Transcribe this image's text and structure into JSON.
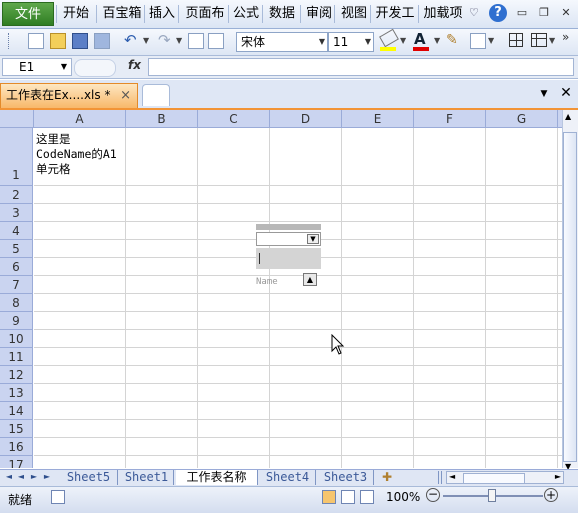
{
  "menu": {
    "file": "文件",
    "items": [
      "开始",
      "百宝箱",
      "插入",
      "页面布",
      "公式",
      "数据",
      "审阅",
      "视图",
      "开发工",
      "加载项"
    ]
  },
  "toolbar": {
    "font_name": "宋体",
    "font_size": "11"
  },
  "formula_bar": {
    "cell_ref": "E1",
    "fx": "fx",
    "value": ""
  },
  "document_tab": {
    "title": "工作表在Ex....xls *",
    "close": "×"
  },
  "grid": {
    "columns": [
      "A",
      "B",
      "C",
      "D",
      "E",
      "F",
      "G"
    ],
    "rows": [
      "1",
      "2",
      "3",
      "4",
      "5",
      "6",
      "7",
      "8",
      "9",
      "10",
      "11",
      "12",
      "13",
      "14",
      "15",
      "16",
      "17"
    ],
    "a1_lines": [
      "这里是",
      "CodeName的A1",
      "单元格"
    ]
  },
  "floating_control": {
    "label_fragment": "Name"
  },
  "sheets": [
    "Sheet5",
    "Sheet1",
    "工作表名称",
    "Sheet4",
    "Sheet3"
  ],
  "active_sheet_index": 2,
  "status": {
    "ready": "就绪",
    "zoom": "100%"
  },
  "colors": {
    "selected_header": "#f6c56e",
    "header": "#cad4f0",
    "file_tab": "#3f8f30",
    "tab_accent": "#f29436"
  }
}
